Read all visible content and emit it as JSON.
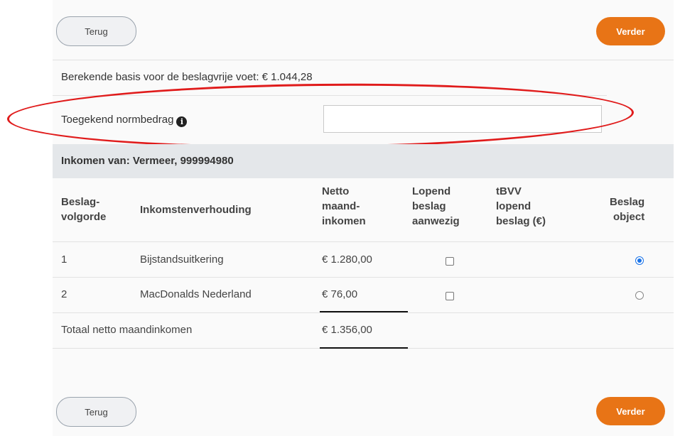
{
  "nav": {
    "back_label": "Terug",
    "next_label": "Verder"
  },
  "basis": {
    "label": "Berekende basis voor de beslagvrije voet: € 1.044,28"
  },
  "normbedrag": {
    "label": "Toegekend normbedrag",
    "value": "",
    "info_icon": "info-icon"
  },
  "income": {
    "header": "Inkomen van: Vermeer, 999994980",
    "columns": {
      "order": [
        "Beslag-",
        "volgorde"
      ],
      "relation": [
        "Inkomstenverhouding"
      ],
      "net": [
        "Netto",
        "maand-",
        "inkomen"
      ],
      "running": [
        "Lopend",
        "beslag",
        "aanwezig"
      ],
      "tbvv": [
        "tBVV",
        "lopend",
        "beslag (€)"
      ],
      "object": [
        "Beslag",
        "object"
      ]
    },
    "rows": [
      {
        "order": "1",
        "relation": "Bijstandsuitkering",
        "net": "€ 1.280,00",
        "running": false,
        "object_selected": true
      },
      {
        "order": "2",
        "relation": "MacDonalds Nederland",
        "net": "€ 76,00",
        "running": false,
        "object_selected": false
      }
    ],
    "total": {
      "label": "Totaal netto maandinkomen",
      "value": "€ 1.356,00"
    }
  },
  "colors": {
    "accent": "#e87416",
    "annotation": "#e01b1b",
    "radio": "#1a73e8"
  }
}
